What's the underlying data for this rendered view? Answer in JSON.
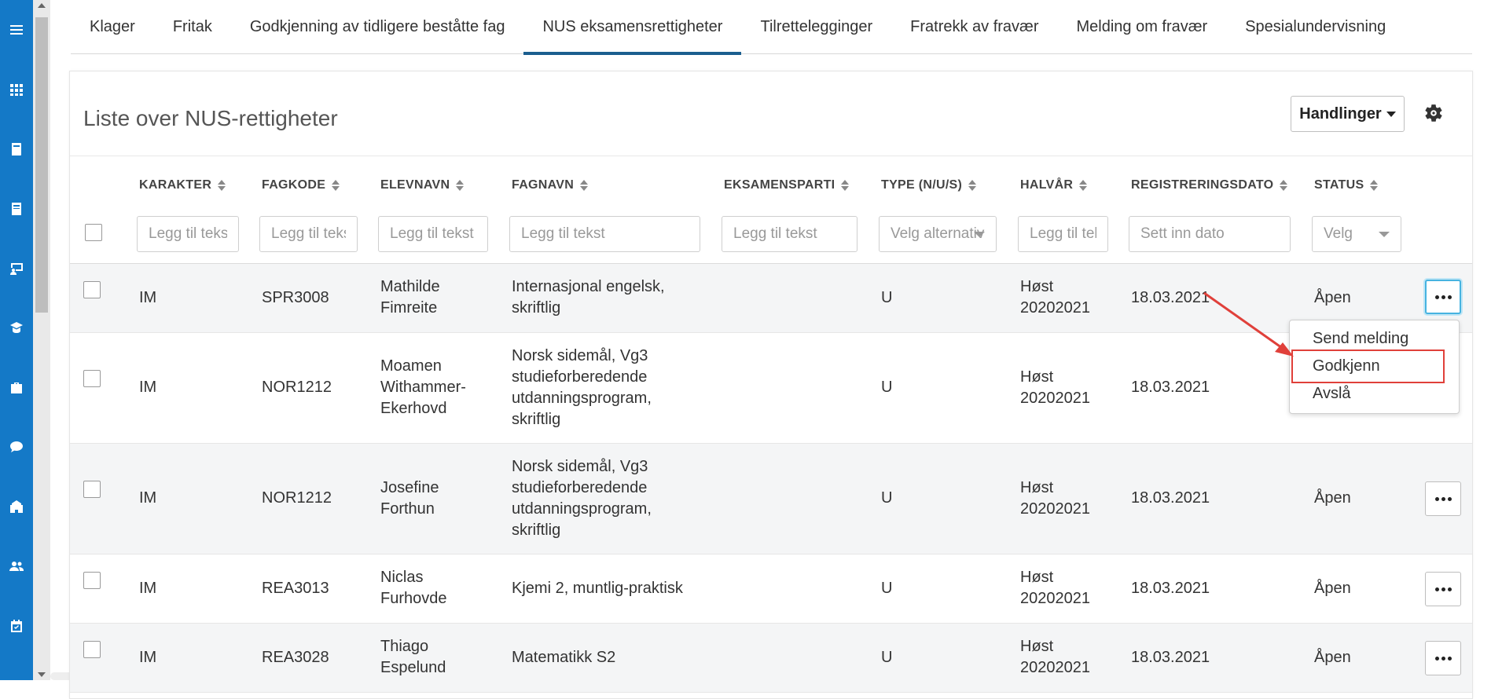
{
  "nav_icons": [
    "menu-icon",
    "grid-icon",
    "book-icon",
    "book-open-icon",
    "teacher-icon",
    "student-icon",
    "briefcase-icon",
    "chat-icon",
    "school-icon",
    "users-icon",
    "calendar-icon"
  ],
  "tabs": [
    {
      "label": "Klager",
      "active": false
    },
    {
      "label": "Fritak",
      "active": false
    },
    {
      "label": "Godkjenning av tidligere beståtte fag",
      "active": false
    },
    {
      "label": "NUS eksamensrettigheter",
      "active": true
    },
    {
      "label": "Tilrettelegginger",
      "active": false
    },
    {
      "label": "Fratrekk av fravær",
      "active": false
    },
    {
      "label": "Melding om fravær",
      "active": false
    },
    {
      "label": "Spesialundervisning",
      "active": false
    }
  ],
  "card": {
    "title": "Liste over NUS-rettigheter",
    "actions_label": "Handlinger"
  },
  "columns": {
    "grade": "KARAKTER",
    "code": "FAGKODE",
    "student": "ELEVNAVN",
    "subject": "FAGNAVN",
    "exam_part": "EKSAMENSPARTI",
    "type": "TYPE (N/U/S)",
    "term": "HALVÅR",
    "reg_date": "REGISTRERINGSDATO",
    "status": "STATUS"
  },
  "filters": {
    "grade": "Legg til tekst",
    "code": "Legg til tekst",
    "student": "Legg til tekst",
    "subject": "Legg til tekst",
    "exam_part": "Legg til tekst",
    "type": "Velg alternativ",
    "term": "Legg til tekst",
    "reg_date": "Sett inn dato",
    "status": "Velg"
  },
  "rows": [
    {
      "grade": "IM",
      "code": "SPR3008",
      "student": [
        "Mathilde",
        "Fimreite"
      ],
      "subject": [
        "Internasjonal engelsk,",
        "skriftlig"
      ],
      "type": "U",
      "term": [
        "Høst",
        "20202021"
      ],
      "reg_date": "18.03.2021",
      "status": "Åpen"
    },
    {
      "grade": "IM",
      "code": "NOR1212",
      "student": [
        "Moamen",
        "Withammer-",
        "Ekerhovd"
      ],
      "subject": [
        "Norsk sidemål, Vg3",
        "studieforberedende",
        "utdanningsprogram,",
        "skriftlig"
      ],
      "type": "U",
      "term": [
        "Høst",
        "20202021"
      ],
      "reg_date": "18.03.2021",
      "status": ""
    },
    {
      "grade": "IM",
      "code": "NOR1212",
      "student": [
        "Josefine",
        "Forthun"
      ],
      "subject": [
        "Norsk sidemål, Vg3",
        "studieforberedende",
        "utdanningsprogram,",
        "skriftlig"
      ],
      "type": "U",
      "term": [
        "Høst",
        "20202021"
      ],
      "reg_date": "18.03.2021",
      "status": "Åpen"
    },
    {
      "grade": "IM",
      "code": "REA3013",
      "student": [
        "Niclas",
        "Furhovde"
      ],
      "subject": [
        "Kjemi 2, muntlig-praktisk"
      ],
      "type": "U",
      "term": [
        "Høst",
        "20202021"
      ],
      "reg_date": "18.03.2021",
      "status": "Åpen"
    },
    {
      "grade": "IM",
      "code": "REA3028",
      "student": [
        "Thiago",
        "Espelund"
      ],
      "subject": [
        "Matematikk S2"
      ],
      "type": "U",
      "term": [
        "Høst",
        "20202021"
      ],
      "reg_date": "18.03.2021",
      "status": "Åpen"
    }
  ],
  "menu": {
    "items": [
      "Send melding",
      "Godkjenn",
      "Avslå"
    ],
    "highlighted": "Godkjenn"
  },
  "colors": {
    "rail": "#1479c7",
    "tab_active": "#1b5e8f",
    "highlight": "#e0403a",
    "focus": "#47b3e0"
  }
}
